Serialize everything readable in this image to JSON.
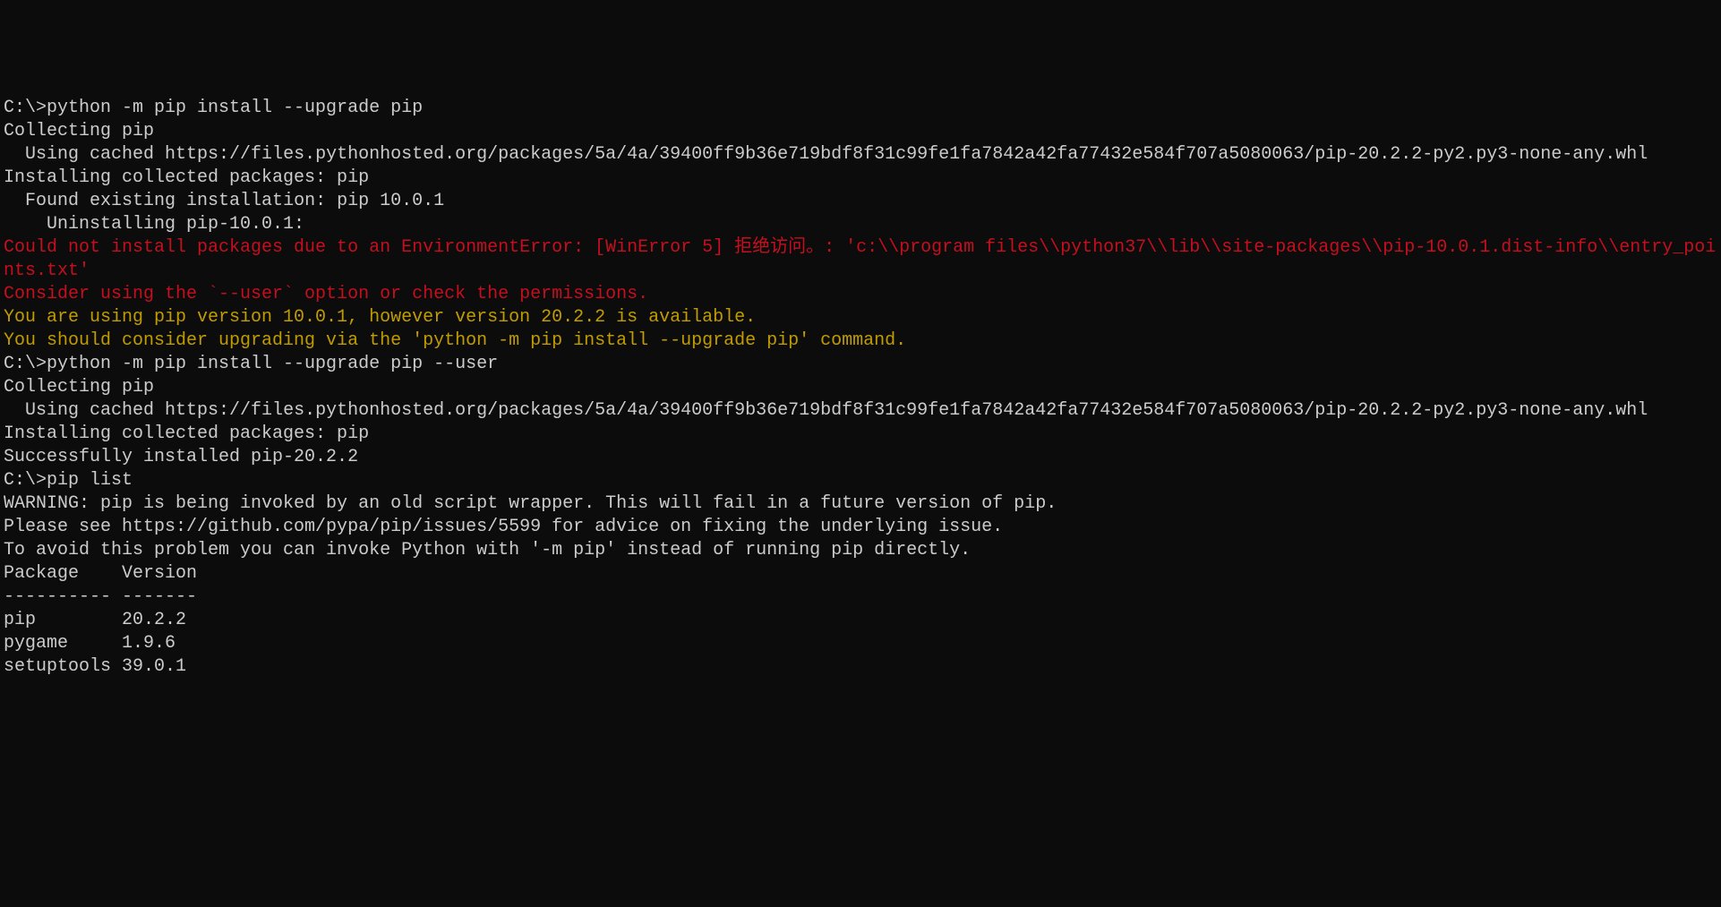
{
  "terminal": {
    "lines": [
      {
        "text": "C:\\>python -m pip install --upgrade pip",
        "color": "white"
      },
      {
        "text": "Collecting pip",
        "color": "white"
      },
      {
        "text": "  Using cached https://files.pythonhosted.org/packages/5a/4a/39400ff9b36e719bdf8f31c99fe1fa7842a42fa77432e584f707a5080063/pip-20.2.2-py2.py3-none-any.whl",
        "color": "white"
      },
      {
        "text": "Installing collected packages: pip",
        "color": "white"
      },
      {
        "text": "  Found existing installation: pip 10.0.1",
        "color": "white"
      },
      {
        "text": "    Uninstalling pip-10.0.1:",
        "color": "white"
      },
      {
        "text": "Could not install packages due to an EnvironmentError: [WinError 5] 拒绝访问。: 'c:\\\\program files\\\\python37\\\\lib\\\\site-packages\\\\pip-10.0.1.dist-info\\\\entry_points.txt'",
        "color": "red"
      },
      {
        "text": "Consider using the `--user` option or check the permissions.",
        "color": "red"
      },
      {
        "text": "",
        "color": "white"
      },
      {
        "text": "You are using pip version 10.0.1, however version 20.2.2 is available.",
        "color": "yellow"
      },
      {
        "text": "You should consider upgrading via the 'python -m pip install --upgrade pip' command.",
        "color": "yellow"
      },
      {
        "text": "",
        "color": "white"
      },
      {
        "text": "C:\\>python -m pip install --upgrade pip --user",
        "color": "white"
      },
      {
        "text": "Collecting pip",
        "color": "white"
      },
      {
        "text": "  Using cached https://files.pythonhosted.org/packages/5a/4a/39400ff9b36e719bdf8f31c99fe1fa7842a42fa77432e584f707a5080063/pip-20.2.2-py2.py3-none-any.whl",
        "color": "white"
      },
      {
        "text": "Installing collected packages: pip",
        "color": "white"
      },
      {
        "text": "Successfully installed pip-20.2.2",
        "color": "white"
      },
      {
        "text": "",
        "color": "white"
      },
      {
        "text": "C:\\>pip list",
        "color": "white"
      },
      {
        "text": "WARNING: pip is being invoked by an old script wrapper. This will fail in a future version of pip.",
        "color": "white"
      },
      {
        "text": "Please see https://github.com/pypa/pip/issues/5599 for advice on fixing the underlying issue.",
        "color": "white"
      },
      {
        "text": "To avoid this problem you can invoke Python with '-m pip' instead of running pip directly.",
        "color": "white"
      },
      {
        "text": "Package    Version",
        "color": "white"
      },
      {
        "text": "---------- -------",
        "color": "white"
      },
      {
        "text": "pip        20.2.2",
        "color": "white"
      },
      {
        "text": "pygame     1.9.6",
        "color": "white"
      },
      {
        "text": "setuptools 39.0.1",
        "color": "white"
      }
    ]
  }
}
